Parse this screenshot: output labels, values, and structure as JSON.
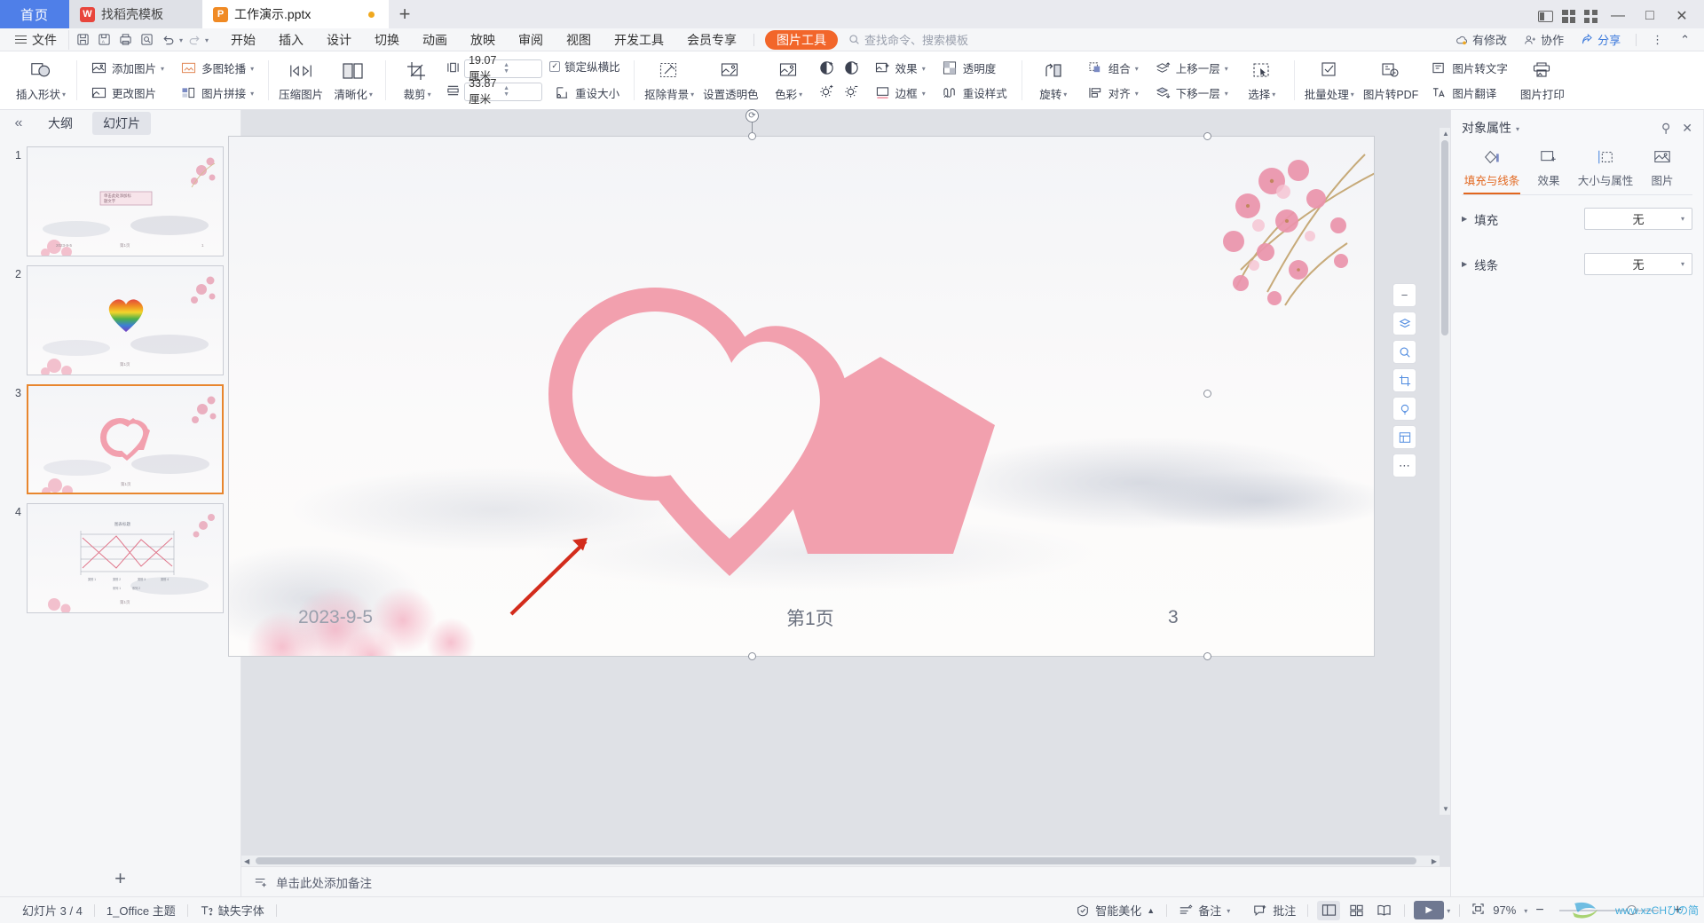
{
  "tabbar": {
    "home_label": "首页",
    "tabs": [
      {
        "label": "找稻壳模板",
        "icon": "docer-icon",
        "icon_text": "W",
        "active": false
      },
      {
        "label": "工作演示.pptx",
        "icon": "pptx-icon",
        "icon_text": "P",
        "active": true
      }
    ],
    "new_tab": "+",
    "window": {
      "minimize": "—",
      "maximize": "□",
      "close": "✕"
    }
  },
  "menubar": {
    "file_label": "文件",
    "quick_access": [
      "save-icon",
      "save-as-icon",
      "print-icon",
      "print-preview-icon",
      "undo-icon",
      "redo-icon",
      "customize-icon"
    ],
    "items": [
      "开始",
      "插入",
      "设计",
      "切换",
      "动画",
      "放映",
      "审阅",
      "视图",
      "开发工具",
      "会员专享"
    ],
    "context_tab": "图片工具",
    "context_tab_color": "#f2662a",
    "search_placeholder": "查找命令、搜索模板",
    "right_items": [
      {
        "label": "有修改",
        "icon": "cloud-sync-icon"
      },
      {
        "label": "协作",
        "icon": "collaborate-icon"
      },
      {
        "label": "分享",
        "icon": "share-icon"
      }
    ],
    "more_icon": "more-vertical-icon",
    "collapse_icon": "chevron-up-icon"
  },
  "ribbon": {
    "groups": [
      {
        "name": "shapes",
        "big": [
          {
            "label": "插入形状",
            "icon": "insert-shape-icon",
            "dropdown": true
          }
        ]
      },
      {
        "name": "picture",
        "col2": [
          {
            "label": "添加图片",
            "icon": "add-picture-icon",
            "dropdown": true
          },
          {
            "label": "更改图片",
            "icon": "change-picture-icon",
            "dropdown": false
          }
        ],
        "col2b": [
          {
            "label": "多图轮播",
            "icon": "multi-carousel-icon",
            "dropdown": true
          },
          {
            "label": "图片拼接",
            "icon": "picture-collage-icon",
            "dropdown": true
          }
        ]
      },
      {
        "name": "compress",
        "big": [
          {
            "label": "压缩图片",
            "icon": "compress-picture-icon",
            "dropdown": false
          },
          {
            "label": "清晰化",
            "icon": "sharpen-icon",
            "dropdown": true
          }
        ]
      },
      {
        "name": "crop-size",
        "big": [
          {
            "label": "裁剪",
            "icon": "crop-icon",
            "dropdown": true
          }
        ],
        "width_value": "19.07厘米",
        "height_value": "33.87厘米",
        "width_icon": "width-icon",
        "height_icon": "height-icon",
        "lock_ratio_label": "锁定纵横比",
        "lock_ratio_checked": true,
        "reset_size_label": "重设大小",
        "reset_size_icon": "reset-size-icon"
      },
      {
        "name": "adjust",
        "big": [
          {
            "label": "抠除背景",
            "icon": "remove-background-icon",
            "dropdown": true
          },
          {
            "label": "设置透明色",
            "icon": "set-transparent-color-icon",
            "dropdown": false
          },
          {
            "label": "色彩",
            "icon": "color-icon",
            "dropdown": true
          }
        ],
        "icons_only": [
          "contrast-up-icon",
          "contrast-down-icon",
          "brightness-up-icon",
          "brightness-down-icon"
        ],
        "col2": [
          {
            "label": "效果",
            "icon": "effects-icon",
            "dropdown": true
          },
          {
            "label": "边框",
            "icon": "border-icon",
            "dropdown": true
          }
        ],
        "col2b": [
          {
            "label": "透明度",
            "icon": "transparency-icon",
            "dropdown": false
          },
          {
            "label": "重设样式",
            "icon": "reset-style-icon",
            "dropdown": false
          }
        ]
      },
      {
        "name": "arrange",
        "big": [
          {
            "label": "旋转",
            "icon": "rotate-icon",
            "dropdown": true
          }
        ],
        "col2": [
          {
            "label": "组合",
            "icon": "group-icon",
            "dropdown": true
          },
          {
            "label": "对齐",
            "icon": "align-icon",
            "dropdown": true
          }
        ],
        "col2b": [
          {
            "label": "上移一层",
            "icon": "bring-forward-icon",
            "dropdown": true
          },
          {
            "label": "下移一层",
            "icon": "send-backward-icon",
            "dropdown": true
          }
        ],
        "big2": [
          {
            "label": "选择",
            "icon": "select-icon",
            "dropdown": true
          }
        ]
      },
      {
        "name": "tools",
        "big": [
          {
            "label": "批量处理",
            "icon": "batch-process-icon",
            "dropdown": true
          },
          {
            "label": "图片转PDF",
            "icon": "picture-to-pdf-icon",
            "dropdown": false
          }
        ],
        "col2": [
          {
            "label": "图片转文字",
            "icon": "picture-to-text-icon",
            "dropdown": false
          },
          {
            "label": "图片翻译",
            "icon": "picture-translate-icon",
            "dropdown": false
          }
        ],
        "big2": [
          {
            "label": "图片打印",
            "icon": "picture-print-icon",
            "dropdown": false
          }
        ]
      }
    ]
  },
  "thumbpane": {
    "collapse_icon": "chevron-double-left-icon",
    "tabs": [
      {
        "label": "大纲",
        "active": false
      },
      {
        "label": "幻灯片",
        "active": true
      }
    ],
    "slides": [
      {
        "number": "1",
        "selected": false,
        "type": "title",
        "footer_date": "2023-9-5",
        "footer_center": "第1页",
        "footer_page": "1"
      },
      {
        "number": "2",
        "selected": false,
        "type": "heart-rainbow",
        "footer_center": "第1页"
      },
      {
        "number": "3",
        "selected": true,
        "type": "heart-pentagon",
        "footer_center": "第1页"
      },
      {
        "number": "4",
        "selected": false,
        "type": "chart",
        "footer_center": "第1页"
      }
    ],
    "add_slide": "+"
  },
  "slide": {
    "footer_date": "2023-9-5",
    "footer_center": "第1页",
    "footer_page": "3",
    "shape_color": "#f2a0ae",
    "arrow_color": "#d32c1c",
    "float_tools": [
      "minus-icon",
      "layers-icon",
      "zoom-icon",
      "crop-tool-icon",
      "bulb-icon",
      "layout-icon",
      "more-dots-icon"
    ]
  },
  "notes": {
    "icon": "notes-icon",
    "placeholder": "单击此处添加备注"
  },
  "properties": {
    "title": "对象属性",
    "pin_icon": "pin-icon",
    "close_icon": "close-icon",
    "tabs": [
      {
        "label": "填充与线条",
        "icon": "fill-line-icon",
        "active": true
      },
      {
        "label": "效果",
        "icon": "effects-panel-icon",
        "active": false
      },
      {
        "label": "大小与属性",
        "icon": "size-properties-icon",
        "active": false
      },
      {
        "label": "图片",
        "icon": "picture-panel-icon",
        "active": false
      }
    ],
    "rows": [
      {
        "label": "填充",
        "value": "无"
      },
      {
        "label": "线条",
        "value": "无"
      }
    ],
    "rail_icons": [
      "feedback-icon",
      "star-icon",
      "slider-icon",
      "sparkle-icon",
      "photo-icon",
      "globe-icon",
      "frame-icon",
      "help-icon"
    ]
  },
  "statusbar": {
    "left": [
      {
        "label": "幻灯片 3 / 4",
        "icon": null
      },
      {
        "label": "1_Office 主题",
        "icon": null
      },
      {
        "label": "缺失字体",
        "icon": "missing-font-icon"
      }
    ],
    "beautify": {
      "label": "智能美化",
      "icon": "beautify-icon",
      "caret": "▲"
    },
    "notes_btn": {
      "label": "备注",
      "icon": "notes-bar-icon"
    },
    "comment_btn": {
      "label": "批注",
      "icon": "comment-icon"
    },
    "views": [
      {
        "name": "normal-view-icon",
        "active": true
      },
      {
        "name": "sorter-view-icon",
        "active": false
      },
      {
        "name": "reading-view-icon",
        "active": false
      }
    ],
    "play_icon": "play-icon",
    "fit_icon": "fit-to-window-icon",
    "zoom_level": "97%",
    "zoom_out": "−",
    "zoom_in": "+",
    "watermark": "www.xzCHひの简"
  }
}
